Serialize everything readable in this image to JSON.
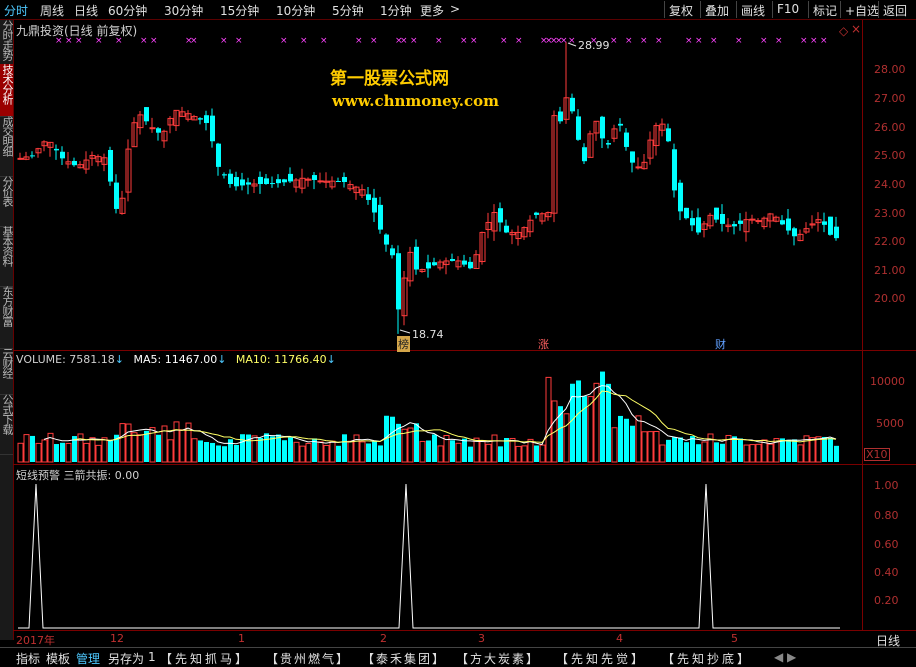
{
  "toolbar": {
    "periods": [
      "分时",
      "周线",
      "日线",
      "60分钟",
      "30分钟",
      "15分钟",
      "10分钟",
      "5分钟",
      "1分钟",
      "更多"
    ],
    "more_arrow": ">",
    "right": [
      "复权",
      "叠加",
      "画线",
      "F10",
      "标记",
      "+自选",
      "返回"
    ]
  },
  "left_tabs": [
    "分时走势",
    "技术分析",
    "成交明细",
    "分价表",
    "基本资料",
    "东方财富",
    "云财经",
    "公式下载"
  ],
  "watermark": {
    "line1": "第一股票公式网",
    "line2": "www.chnmoney.com"
  },
  "main_panel": {
    "title": "九鼎投资(日线 前复权)",
    "high_label": "28.99",
    "low_label": "18.74",
    "event_tags": [
      "榜",
      "涨",
      "财"
    ],
    "marker_symbol": "×",
    "y_axis": [
      "28.00",
      "27.00",
      "26.00",
      "25.00",
      "24.00",
      "23.00",
      "22.00",
      "21.00",
      "20.00"
    ]
  },
  "volume_panel": {
    "volume_label": "VOLUME: 7581.18",
    "ma5_label": "MA5: 11467.00",
    "ma10_label": "MA10: 11766.40",
    "y_axis": [
      "10000",
      "5000"
    ],
    "unit": "X10"
  },
  "indicator_panel": {
    "title": "短线预警 三箭共振: 0.00",
    "y_axis": [
      "1.00",
      "0.80",
      "0.60",
      "0.40",
      "0.20"
    ]
  },
  "time_axis": {
    "labels": [
      "2017年",
      "12",
      "1",
      "2",
      "3",
      "4",
      "5"
    ],
    "period": "日线"
  },
  "bottom_tabs": [
    "指标",
    "模板",
    "管理",
    "另存为",
    "1",
    "【先知抓马】",
    "【贵州燃气】",
    "【泰禾集团】",
    "【方大炭素】",
    "【先知先觉】",
    "【先知抄底】"
  ],
  "bottom_arrows": "◀ ▶",
  "colors": {
    "up": "#ff3c3c",
    "down": "#00ffff",
    "border": "#7a0000",
    "ma5": "#ffffff",
    "ma10": "#ffff66",
    "signal": "#ffffff",
    "marker": "#ff44ff"
  }
}
